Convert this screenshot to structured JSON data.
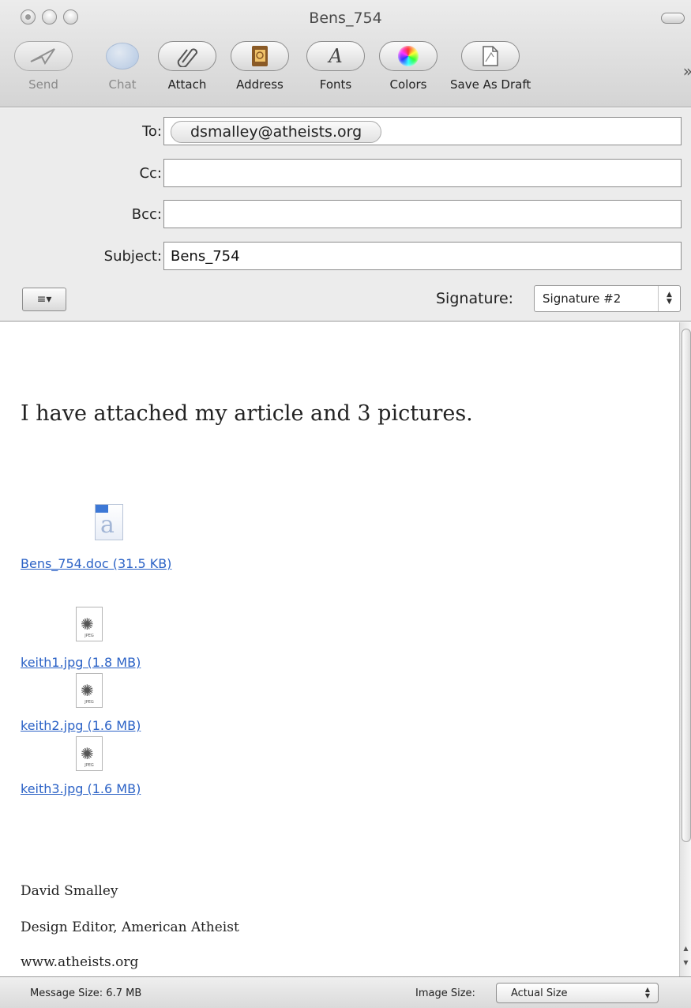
{
  "window": {
    "title": "Bens_754"
  },
  "toolbar": {
    "items": [
      {
        "label": "Send",
        "icon": "send-icon"
      },
      {
        "label": "Chat",
        "icon": "chat-icon"
      },
      {
        "label": "Attach",
        "icon": "paperclip-icon"
      },
      {
        "label": "Address",
        "icon": "address-book-icon"
      },
      {
        "label": "Fonts",
        "icon": "font-icon"
      },
      {
        "label": "Colors",
        "icon": "color-wheel-icon"
      },
      {
        "label": "Save As Draft",
        "icon": "save-draft-icon"
      }
    ],
    "overflow_glyph": "»"
  },
  "headers": {
    "to_label": "To:",
    "to_recipient": "dsmalley@atheists.org",
    "cc_label": "Cc:",
    "cc_value": "",
    "bcc_label": "Bcc:",
    "bcc_value": "",
    "subject_label": "Subject:",
    "subject_value": "Bens_754",
    "format_glyph": "≡▾",
    "signature_label": "Signature:",
    "signature_value": "Signature #2"
  },
  "body": {
    "message": "I have attached my article and 3 pictures.",
    "attachments": [
      {
        "label": "Bens_754.doc (31.5 KB)",
        "icon": "word-document-icon"
      },
      {
        "label": "keith1.jpg (1.8 MB)",
        "icon": "jpeg-file-icon"
      },
      {
        "label": "keith2.jpg (1.6 MB)",
        "icon": "jpeg-file-icon"
      },
      {
        "label": "keith3.jpg (1.6 MB)",
        "icon": "jpeg-file-icon"
      }
    ],
    "jpeg_tag": "JPEG",
    "signature_lines": [
      "David Smalley",
      "Design Editor, American Atheist",
      "www.atheists.org"
    ]
  },
  "status": {
    "message_size": "Message Size: 6.7 MB",
    "image_size_label": "Image Size:",
    "image_size_value": "Actual Size"
  },
  "colors": {
    "link": "#2b62c6",
    "toolbar_bg": "#d4d4d4",
    "header_bg": "#ececec"
  }
}
